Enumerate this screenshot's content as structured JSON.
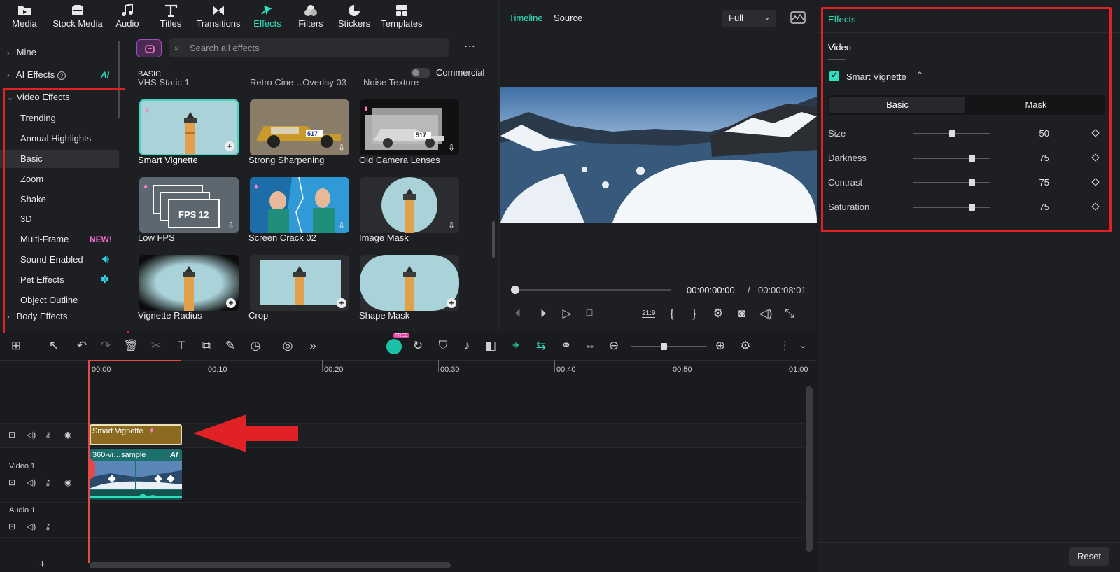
{
  "toolbar": {
    "items": [
      {
        "label": "Media"
      },
      {
        "label": "Stock Media"
      },
      {
        "label": "Audio"
      },
      {
        "label": "Titles"
      },
      {
        "label": "Transitions"
      },
      {
        "label": "Effects"
      },
      {
        "label": "Filters"
      },
      {
        "label": "Stickers"
      },
      {
        "label": "Templates"
      }
    ],
    "active": "Effects"
  },
  "left_nav": {
    "mine": "Mine",
    "ai_effects": "AI Effects",
    "ai_badge": "AI",
    "video_effects": "Video Effects",
    "sub_items": [
      {
        "label": "Trending"
      },
      {
        "label": "Annual Highlights"
      },
      {
        "label": "Basic"
      },
      {
        "label": "Zoom"
      },
      {
        "label": "Shake"
      },
      {
        "label": "3D"
      },
      {
        "label": "Multi-Frame"
      },
      {
        "label": "Sound-Enabled"
      },
      {
        "label": "Pet Effects"
      },
      {
        "label": "Object Outline"
      }
    ],
    "new_badge": "NEW!",
    "body_effects": "Body Effects",
    "selected": "Basic"
  },
  "effects_panel": {
    "search_placeholder": "Search all effects",
    "section_title": "BASIC",
    "commercial_label": "Commercial",
    "top_partial": [
      "VHS Static 1",
      "Retro Cine…Overlay 03",
      "Noise Texture"
    ],
    "items": [
      {
        "label": "Smart Vignette"
      },
      {
        "label": "Strong Sharpening"
      },
      {
        "label": "Old Camera Lenses"
      },
      {
        "label": "Low FPS"
      },
      {
        "label": "Screen Crack 02"
      },
      {
        "label": "Image Mask"
      },
      {
        "label": "Vignette Radius"
      },
      {
        "label": "Crop"
      },
      {
        "label": "Shape Mask"
      }
    ],
    "fps_text": "FPS 12",
    "plate_text": "517"
  },
  "viewer": {
    "tab_timeline": "Timeline",
    "tab_source": "Source",
    "zoom": "Full",
    "time_current": "00:00:00:00",
    "time_separator": "/",
    "time_total": "00:00:08:01",
    "aspect": "21:9"
  },
  "properties": {
    "header": "Effects",
    "tab_video": "Video",
    "effect_name": "Smart Vignette",
    "tab_basic": "Basic",
    "tab_mask": "Mask",
    "params": [
      {
        "label": "Size",
        "value": "50",
        "level": 0.5
      },
      {
        "label": "Darkness",
        "value": "75",
        "level": 0.75
      },
      {
        "label": "Contrast",
        "value": "75",
        "level": 0.75
      },
      {
        "label": "Saturation",
        "value": "75",
        "level": 0.75
      }
    ],
    "reset": "Reset"
  },
  "timeline": {
    "ruler": [
      "00:00",
      "00:10",
      "00:20",
      "00:30",
      "00:40",
      "00:50",
      "01:00"
    ],
    "effect_clip": "Smart Vignette",
    "video_clip": "360-vi…sample",
    "video_clip_badge": "AI",
    "track_video": "Video 1",
    "track_audio": "Audio 1",
    "free_badge": "FREE"
  },
  "colors": {
    "accent": "#2fe0c0",
    "highlight": "#e02227",
    "effect_clip": "#8c6a1f",
    "video_clip": "#1c6f6a"
  }
}
